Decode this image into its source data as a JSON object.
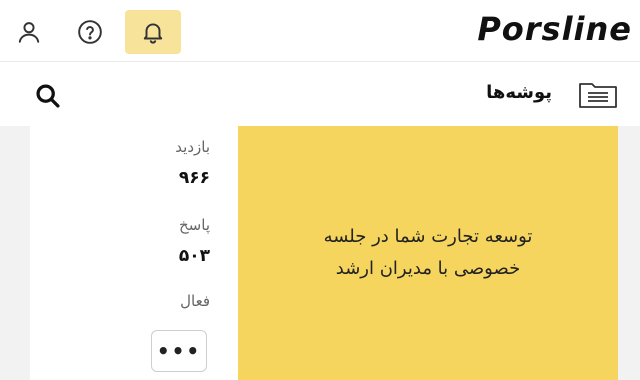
{
  "header": {
    "brand": "Porsline",
    "icons": [
      "user-icon",
      "help-icon",
      "bell-icon"
    ],
    "bell_bg": "#f7e39a"
  },
  "subheader": {
    "title": "پوشه‌ها",
    "icons": [
      "folder-icon",
      "search-icon"
    ]
  },
  "survey_card": {
    "banner_line1": "توسعه تجارت شما در جلسه",
    "banner_line2": "خصوصی با مدیران ارشد",
    "banner_color": "#f5d55e",
    "stats": {
      "visits_label": "بازدید",
      "visits_value": "۹۶۶",
      "answers_label": "پاسخ",
      "answers_value": "۵۰۳",
      "status_label": "فعال"
    },
    "more_label": "•••"
  }
}
